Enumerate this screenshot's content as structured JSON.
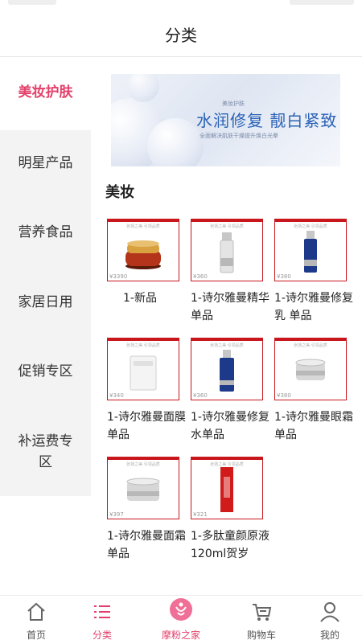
{
  "header": {
    "title": "分类"
  },
  "sidebar": {
    "items": [
      {
        "label": "美妆护肤"
      },
      {
        "label": "明星产品"
      },
      {
        "label": "营养食品"
      },
      {
        "label": "家居日用"
      },
      {
        "label": "促销专区"
      },
      {
        "label": "补运费专区"
      }
    ]
  },
  "banner": {
    "small": "美妆护肤",
    "main": "水润修复 靓白紧致",
    "sub": "全面解决肌肤干燥提升焕白光晕"
  },
  "section": {
    "title": "美妆"
  },
  "products": [
    {
      "name": "1-新品",
      "price": "¥3390",
      "slogan": "张扬之美 引领品质"
    },
    {
      "name": "1-诗尔雅曼精华单品",
      "price": "¥360",
      "slogan": "张扬之美 引领品质"
    },
    {
      "name": "1-诗尔雅曼修复乳 单品",
      "price": "¥380",
      "slogan": "张扬之美 引领品质"
    },
    {
      "name": "1-诗尔雅曼面膜单品",
      "price": "¥340",
      "slogan": "张扬之美 引领品质"
    },
    {
      "name": "1-诗尔雅曼修复水单品",
      "price": "¥360",
      "slogan": "张扬之美 引领品质"
    },
    {
      "name": "1-诗尔雅曼眼霜单品",
      "price": "¥380",
      "slogan": "张扬之美 引领品质"
    },
    {
      "name": "1-诗尔雅曼面霜单品",
      "price": "¥397",
      "slogan": "张扬之美 引领品质"
    },
    {
      "name": "1-多肽童颜原液120ml贺岁",
      "price": "¥321",
      "slogan": "张扬之美 引领品质"
    }
  ],
  "tabbar": {
    "tabs": [
      {
        "label": "首页",
        "icon": "home-icon"
      },
      {
        "label": "分类",
        "icon": "category-icon"
      },
      {
        "label": "摩粉之家",
        "icon": "brand-icon"
      },
      {
        "label": "购物车",
        "icon": "cart-icon"
      },
      {
        "label": "我的",
        "icon": "user-icon"
      }
    ]
  },
  "colors": {
    "accent": "#e2406a",
    "frame": "#c9161d"
  }
}
